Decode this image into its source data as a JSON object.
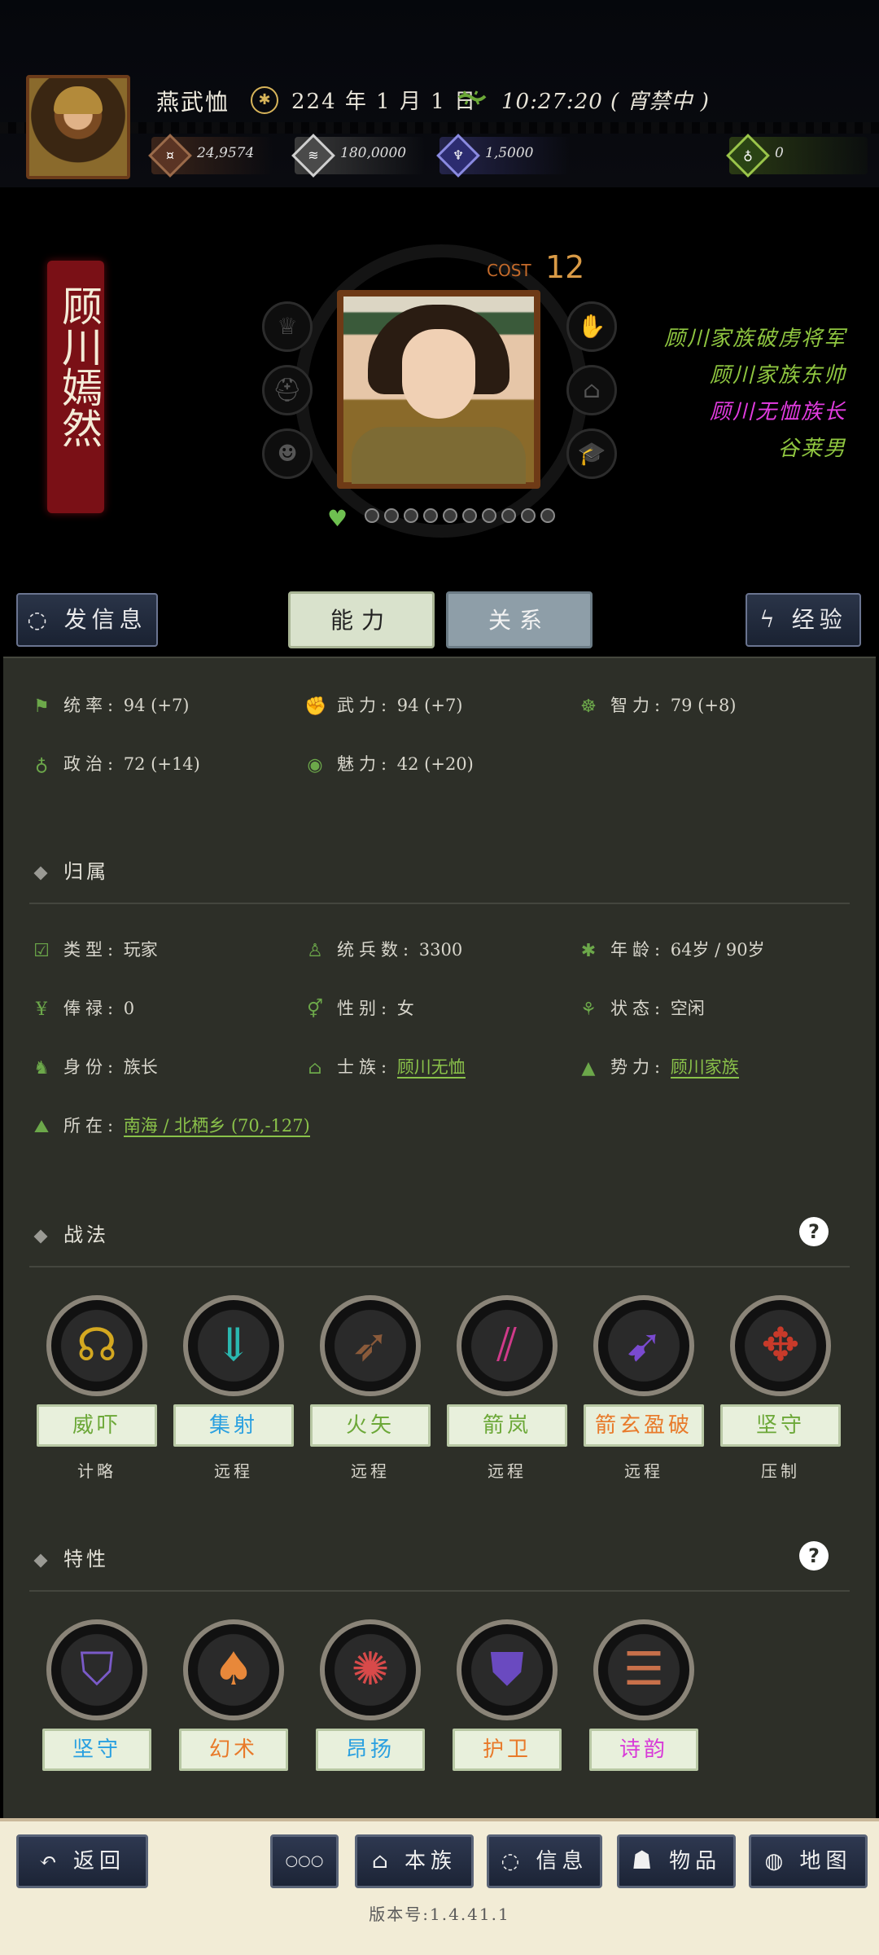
{
  "topbar": {
    "player_name": "燕武恤",
    "date_icon": "calendar-seal-icon",
    "date": "224 年 1 月 1 日",
    "time_icon": "lizard-icon",
    "time": "10:27:20 ( 宵禁中 )",
    "resources": {
      "copper": "24,9574",
      "silver": "180,0000",
      "power": "1,5000",
      "gem": "0"
    }
  },
  "character": {
    "name": "顾川嫣然",
    "cost_label": "COST",
    "cost_value": "12",
    "titles": [
      {
        "text": "顾川家族破虏将军",
        "color": "#8fc640"
      },
      {
        "text": "顾川家族东帅",
        "color": "#8fc640"
      },
      {
        "text": "顾川无恤族长",
        "color": "#e23ce0"
      },
      {
        "text": "谷莱男",
        "color": "#8fc640"
      }
    ],
    "favor_dots": 10
  },
  "tabs": {
    "message": "发信息",
    "ability": "能力",
    "relation": "关系",
    "experience": "经验"
  },
  "stats": {
    "command_label": "统率:",
    "command_value": "94 (+7)",
    "force_label": "武力:",
    "force_value": "94 (+7)",
    "intellect_label": "智力:",
    "intellect_value": "79 (+8)",
    "politics_label": "政治:",
    "politics_value": "72 (+14)",
    "charm_label": "魅力:",
    "charm_value": "42 (+20)"
  },
  "affiliation": {
    "title": "归属",
    "type_label": "类型:",
    "type_value": "玩家",
    "troops_label": "统兵数:",
    "troops_value": "3300",
    "age_label": "年龄:",
    "age_value": "64岁 / 90岁",
    "salary_label": "俸禄:",
    "salary_value": "0",
    "gender_label": "性别:",
    "gender_value": "女",
    "status_label": "状态:",
    "status_value": "空闲",
    "identity_label": "身份:",
    "identity_value": "族长",
    "clan_label": "士族:",
    "clan_value": "顾川无恤",
    "faction_label": "势力:",
    "faction_value": "顾川家族",
    "location_label": "所在:",
    "location_value": "南海 / 北栖乡 (70,-127)"
  },
  "tactics": {
    "title": "战法",
    "items": [
      {
        "name": "威吓",
        "type": "计略",
        "icon": "roar-icon",
        "color": "#6ca838",
        "glyph_color": "#d4a820"
      },
      {
        "name": "集射",
        "type": "远程",
        "icon": "arrow-volley-icon",
        "color": "#2aa0e0",
        "glyph_color": "#2ab8b0"
      },
      {
        "name": "火矢",
        "type": "远程",
        "icon": "fire-arrow-icon",
        "color": "#6ca838",
        "glyph_color": "#8a5a3a"
      },
      {
        "name": "箭岚",
        "type": "远程",
        "icon": "arrow-storm-icon",
        "color": "#6ca838",
        "glyph_color": "#d03a8a"
      },
      {
        "name": "箭玄盈破",
        "type": "远程",
        "icon": "piercing-arrow-icon",
        "color": "#e87a2a",
        "glyph_color": "#7a4ad0"
      },
      {
        "name": "坚守",
        "type": "压制",
        "icon": "defend-icon",
        "color": "#6ca838",
        "glyph_color": "#c83a2a"
      }
    ]
  },
  "traits": {
    "title": "特性",
    "items": [
      {
        "name": "坚守",
        "icon": "shields-icon",
        "color": "#2aa0e0",
        "glyph_color": "#7a5ac8"
      },
      {
        "name": "幻术",
        "icon": "illusionist-icon",
        "color": "#e87a2a",
        "glyph_color": "#e8883a"
      },
      {
        "name": "昂扬",
        "icon": "morale-icon",
        "color": "#2aa0e0",
        "glyph_color": "#d84a4a"
      },
      {
        "name": "护卫",
        "icon": "guard-shield-icon",
        "color": "#e87a2a",
        "glyph_color": "#6a4ac0"
      },
      {
        "name": "诗韵",
        "icon": "poetry-icon",
        "color": "#d83ad8",
        "glyph_color": "#c8704a"
      }
    ]
  },
  "bottom": {
    "back": "返回",
    "more": "○○○",
    "clan": "本族",
    "info": "信息",
    "items": "物品",
    "map": "地图",
    "version": "版本号:1.4.41.1"
  }
}
